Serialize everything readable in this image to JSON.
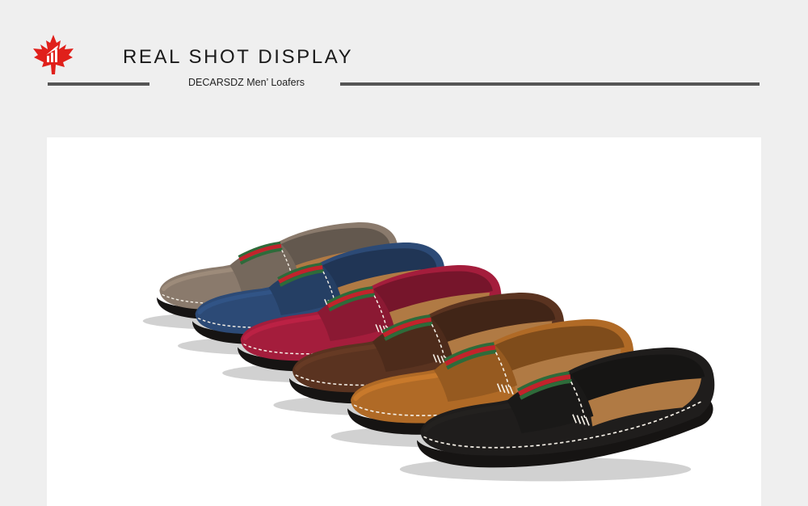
{
  "header": {
    "title": "REAL SHOT DISPLAY",
    "subtitle": "DECARSDZ Men’ Loafers",
    "logo_icon": "maple-leaf-chart-icon",
    "logo_color": "#e0201b",
    "rule_color": "#555555"
  },
  "product_photo": {
    "subject": "loafers",
    "shoes": [
      {
        "color_name": "taupe",
        "color": "#8a7a6c"
      },
      {
        "color_name": "navy",
        "color": "#2c4a76"
      },
      {
        "color_name": "burgundy",
        "color": "#a41d3c"
      },
      {
        "color_name": "brown",
        "color": "#5a3320"
      },
      {
        "color_name": "tan",
        "color": "#b06a26"
      },
      {
        "color_name": "black",
        "color": "#1f1d1c"
      }
    ],
    "stripe_colors": [
      "#2e6b3a",
      "#c2232b",
      "#2e6b3a"
    ]
  }
}
